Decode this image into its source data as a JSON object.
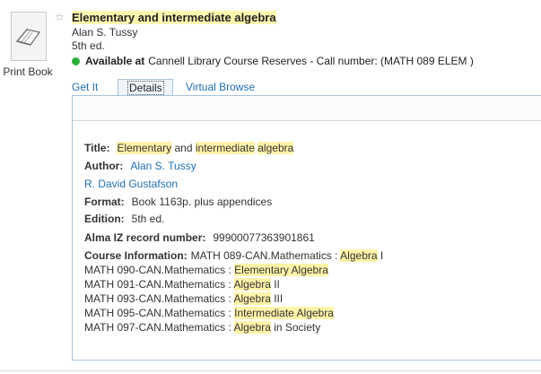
{
  "record": {
    "type_label": "Print Book",
    "title": "Elementary and intermediate algebra",
    "author": "Alan S. Tussy",
    "edition": "5th ed.",
    "availability": {
      "status": "Available at",
      "location": "Cannell Library Course Reserves - Call number: (MATH 089 ELEM )"
    }
  },
  "tabs": [
    {
      "label": "Get It"
    },
    {
      "label": "Details"
    },
    {
      "label": "Virtual Browse"
    }
  ],
  "details": {
    "title_label": "Title:",
    "title_parts": [
      "Elementary",
      " and ",
      "intermediate",
      " ",
      "algebra"
    ],
    "author_label": "Author:",
    "author": "Alan S. Tussy",
    "coauthor": "R. David Gustafson",
    "format_label": "Format:",
    "format": "Book 1163p. plus appendices",
    "edition_label": "Edition:",
    "edition": "5th ed.",
    "alma_label": "Alma IZ record number:",
    "alma_value": "99900077363901861",
    "course_label": "Course Information:",
    "courses": [
      {
        "prefix": "MATH 089-CAN.Mathematics : ",
        "hl": "Algebra",
        "suffix": " I"
      },
      {
        "prefix": "MATH 090-CAN.Mathematics : ",
        "hl": "Elementary Algebra",
        "suffix": ""
      },
      {
        "prefix": "MATH 091-CAN.Mathematics : ",
        "hl": "Algebra",
        "suffix": " II"
      },
      {
        "prefix": "MATH 093-CAN.Mathematics : ",
        "hl": "Algebra",
        "suffix": " III"
      },
      {
        "prefix": "MATH 095-CAN.Mathematics : ",
        "hl": "Intermediate Algebra",
        "suffix": ""
      },
      {
        "prefix": "MATH 097-CAN.Mathematics : ",
        "hl": "Algebra",
        "suffix": " in Society"
      }
    ]
  },
  "colors": {
    "link": "#1f6fb2",
    "highlight": "#fff3a8",
    "available": "#2eaf3a",
    "tab_border": "#a9c4dc"
  },
  "icons": {
    "book": "book-icon",
    "star": "star-icon",
    "availability": "availability-dot-icon"
  }
}
